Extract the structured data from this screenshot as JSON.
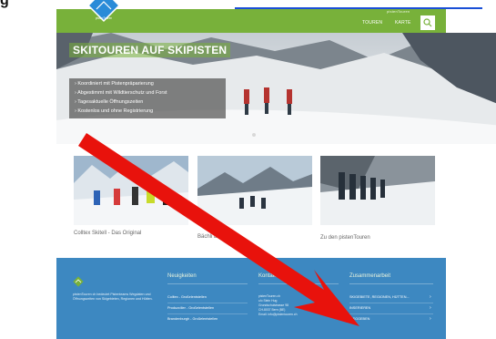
{
  "page": {
    "fragment_left": "g",
    "fragment_link": "...",
    "brand_small": "pistenTouren",
    "logo_text": "pistenTouren"
  },
  "nav": {
    "items": [
      "TOUREN",
      "KARTE"
    ],
    "search_icon": "search-icon"
  },
  "hero": {
    "title": "SKITOUREN AUF SKIPISTEN",
    "bullets": [
      "Koordiniert mit Pistenpräparierung",
      "Abgestimmt mit Wildtierschutz und Forst",
      "Tagesaktuelle Öffnungszeiten",
      "Kostenlos und ohne Registrierung"
    ]
  },
  "thumbnails": [
    {
      "label": "Colltex Skitell - Das Original"
    },
    {
      "label": "Bächli Be..."
    },
    {
      "label": "Zu den pistenTouren"
    }
  ],
  "footer": {
    "about": "pistenTouren ch bedeutet Pistenteams Wegdaten und Öffnungszeiten von Skigebieten, Regionen und Hütten.",
    "news": {
      "heading": "Neuigkeiten",
      "items": [
        "Colltex - Großelentstellen",
        "Produzcilier - Großelentstellen",
        "Brandenburgh - Großelentstellen"
      ]
    },
    "contact": {
      "heading": "Kontakt",
      "lines": [
        "pistenTouren.ch",
        "c/o Stein Hug",
        "Grundschulstrasse 98",
        "CH-8037 Bern (BE)",
        "Email: info@pistentouren.ch"
      ]
    },
    "partners": {
      "heading": "Zusammenarbeit",
      "items": [
        "SKIGEBIETE, REGIONEN, HÜTTEN...",
        "INSERIEREN",
        "SIEGGEBEN"
      ]
    }
  },
  "colors": {
    "brand_green": "#78b13a",
    "footer_blue": "#3d88c1",
    "annotation_red": "#e8120c"
  }
}
